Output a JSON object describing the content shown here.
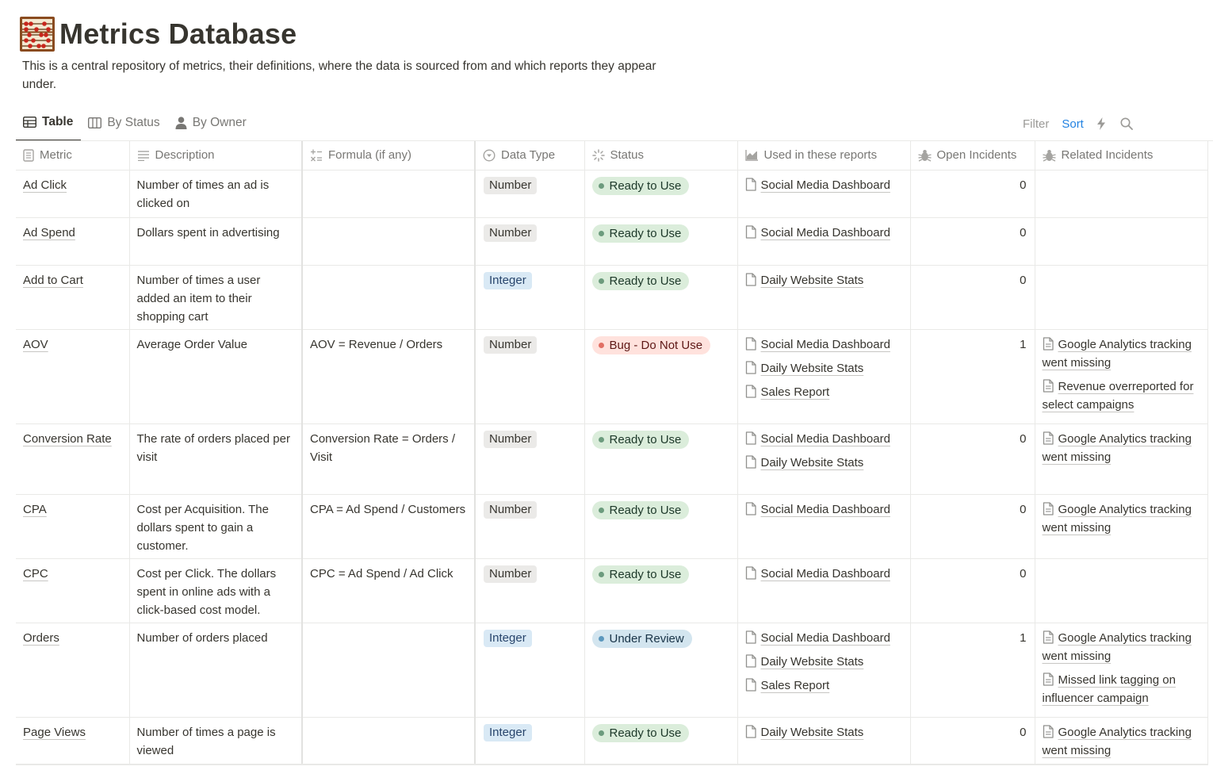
{
  "page": {
    "title": "Metrics Database",
    "description": "This is a central repository of metrics, their definitions, where the data is sourced from and which reports they appear under."
  },
  "views": [
    "Table",
    "By Status",
    "By Owner"
  ],
  "toolbar": {
    "filter": "Filter",
    "sort": "Sort"
  },
  "columns": {
    "metric": "Metric",
    "description": "Description",
    "formula": "Formula (if any)",
    "data_type": "Data Type",
    "status": "Status",
    "reports": "Used in these reports",
    "open_incidents": "Open Incidents",
    "related_incidents": "Related Incidents"
  },
  "rows": [
    {
      "metric": "Ad Click",
      "description": "Number of times an ad is clicked on",
      "formula": "",
      "data_type": "Number",
      "status": "Ready to Use",
      "reports": [
        "Social Media Dashboard"
      ],
      "open_incidents": "0",
      "related": []
    },
    {
      "metric": "Ad Spend",
      "description": "Dollars spent in advertising",
      "formula": "",
      "data_type": "Number",
      "status": "Ready to Use",
      "reports": [
        "Social Media Dashboard"
      ],
      "open_incidents": "0",
      "related": []
    },
    {
      "metric": "Add to Cart",
      "description": "Number of times a user added an item to their shopping cart",
      "formula": "",
      "data_type": "Integer",
      "status": "Ready to Use",
      "reports": [
        "Daily Website Stats"
      ],
      "open_incidents": "0",
      "related": []
    },
    {
      "metric": "AOV",
      "description": "Average Order Value",
      "formula": "AOV = Revenue / Orders",
      "data_type": "Number",
      "status": "Bug - Do Not Use",
      "reports": [
        "Social Media Dashboard",
        "Daily Website Stats",
        "Sales Report"
      ],
      "open_incidents": "1",
      "related": [
        "Google Analytics tracking went missing",
        "Revenue overreported for select campaigns"
      ]
    },
    {
      "metric": "Conversion Rate",
      "description": "The rate of orders placed per visit",
      "formula": "Conversion Rate = Orders / Visit",
      "data_type": "Number",
      "status": "Ready to Use",
      "reports": [
        "Social Media Dashboard",
        "Daily Website Stats"
      ],
      "open_incidents": "0",
      "related": [
        "Google Analytics tracking went missing"
      ]
    },
    {
      "metric": "CPA",
      "description": "Cost per Acquisition. The dollars spent to gain a customer.",
      "formula": "CPA = Ad Spend / Customers",
      "data_type": "Number",
      "status": "Ready to Use",
      "reports": [
        "Social Media Dashboard"
      ],
      "open_incidents": "0",
      "related": [
        "Google Analytics tracking went missing"
      ]
    },
    {
      "metric": "CPC",
      "description": "Cost per Click. The dollars spent in online ads with a click-based cost model.",
      "formula": "CPC = Ad Spend / Ad Click",
      "data_type": "Number",
      "status": "Ready to Use",
      "reports": [
        "Social Media Dashboard"
      ],
      "open_incidents": "0",
      "related": []
    },
    {
      "metric": "Orders",
      "description": "Number of orders placed",
      "formula": "",
      "data_type": "Integer",
      "status": "Under Review",
      "reports": [
        "Social Media Dashboard",
        "Daily Website Stats",
        "Sales Report"
      ],
      "open_incidents": "1",
      "related": [
        "Google Analytics tracking went missing",
        "Missed link tagging on influencer campaign"
      ]
    },
    {
      "metric": "Page Views",
      "description": "Number of times a page is viewed",
      "formula": "",
      "data_type": "Integer",
      "status": "Ready to Use",
      "reports": [
        "Daily Website Stats"
      ],
      "open_incidents": "0",
      "related": [
        "Google Analytics tracking went missing"
      ]
    }
  ],
  "colors": {
    "ready_bg": "#dbeddb",
    "bug_bg": "#ffe2dd",
    "review_bg": "#d3e5ef",
    "number_bg": "#ebeae8",
    "integer_bg": "#d9e9f5",
    "accent": "#2383e2"
  }
}
